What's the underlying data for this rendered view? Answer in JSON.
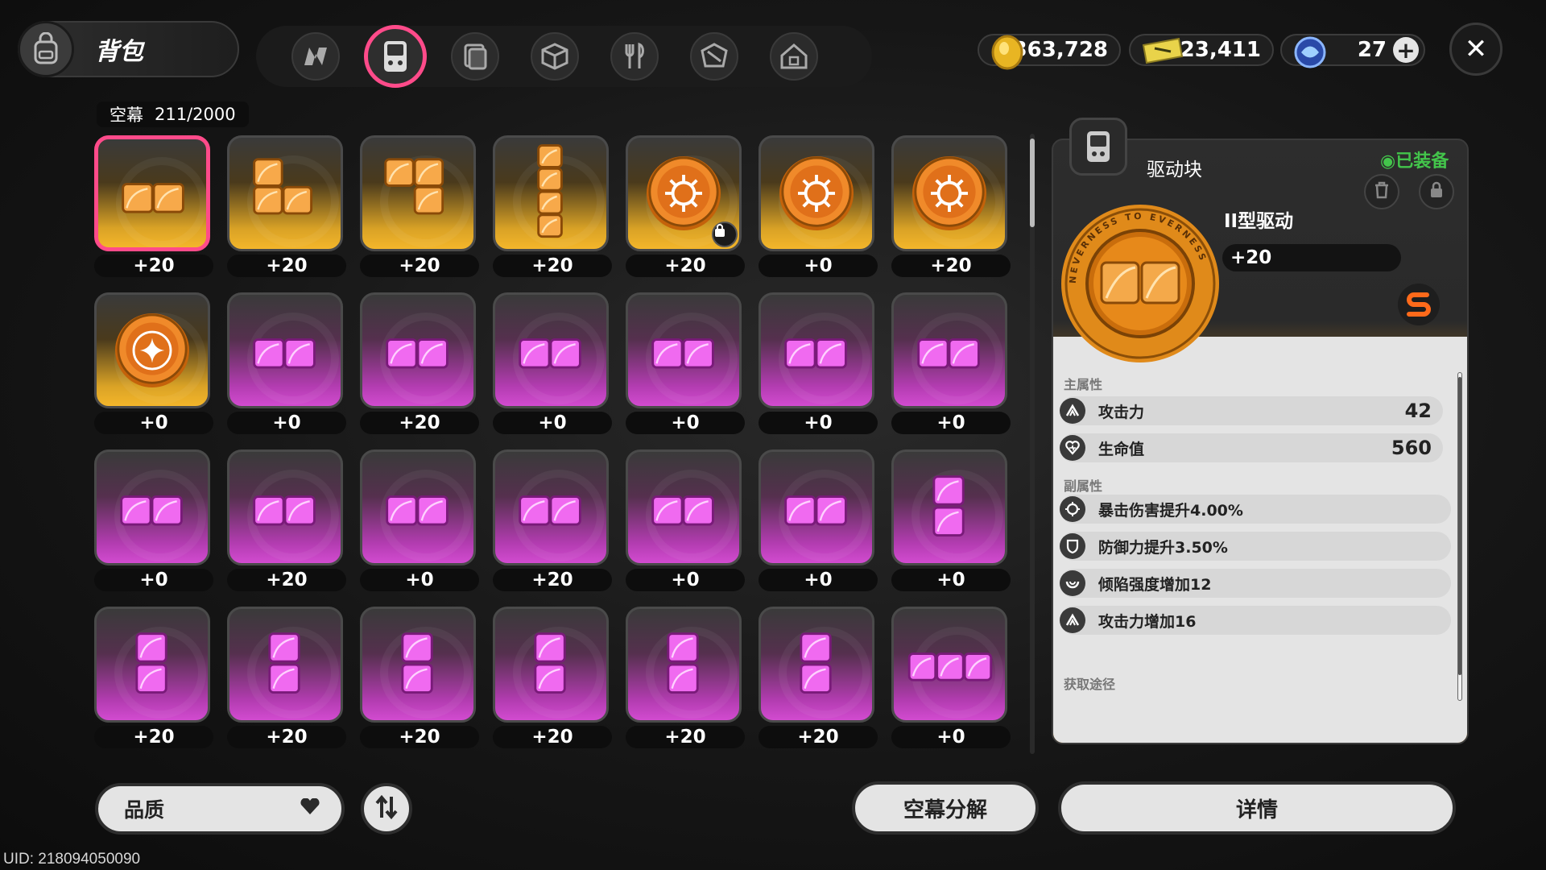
{
  "header": {
    "title": "背包",
    "tabs": [
      {
        "icon": "n-logo-icon",
        "active": false
      },
      {
        "icon": "handheld-device-icon",
        "active": true
      },
      {
        "icon": "cards-icon",
        "active": false
      },
      {
        "icon": "box-icon",
        "active": false
      },
      {
        "icon": "fork-knife-icon",
        "active": false
      },
      {
        "icon": "package-icon",
        "active": false
      },
      {
        "icon": "house-icon",
        "active": false
      }
    ]
  },
  "currencies": [
    {
      "icon": "gold-coin-icon",
      "value": "363,728"
    },
    {
      "icon": "ticket-icon",
      "value": "23,411"
    },
    {
      "icon": "polychrome-icon",
      "value": "27"
    }
  ],
  "inventory": {
    "label": "空幕",
    "count": "211/2000",
    "items": [
      {
        "rarity": "gold",
        "shape": "h2",
        "level": "+20",
        "selected": true
      },
      {
        "rarity": "gold",
        "shape": "L",
        "level": "+20"
      },
      {
        "rarity": "gold",
        "shape": "J",
        "level": "+20"
      },
      {
        "rarity": "gold",
        "shape": "v4",
        "level": "+20"
      },
      {
        "rarity": "gold",
        "shape": "coin",
        "level": "+20",
        "locked": true
      },
      {
        "rarity": "gold",
        "shape": "coin",
        "level": "+0"
      },
      {
        "rarity": "gold",
        "shape": "coin",
        "level": "+20"
      },
      {
        "rarity": "gold",
        "shape": "coin2",
        "level": "+0"
      },
      {
        "rarity": "pink",
        "shape": "h2",
        "level": "+0"
      },
      {
        "rarity": "pink",
        "shape": "h2",
        "level": "+20"
      },
      {
        "rarity": "pink",
        "shape": "h2",
        "level": "+0"
      },
      {
        "rarity": "pink",
        "shape": "h2",
        "level": "+0"
      },
      {
        "rarity": "pink",
        "shape": "h2",
        "level": "+0"
      },
      {
        "rarity": "pink",
        "shape": "h2",
        "level": "+0"
      },
      {
        "rarity": "pink",
        "shape": "h2",
        "level": "+0"
      },
      {
        "rarity": "pink",
        "shape": "h2",
        "level": "+20"
      },
      {
        "rarity": "pink",
        "shape": "h2",
        "level": "+0"
      },
      {
        "rarity": "pink",
        "shape": "h2",
        "level": "+20"
      },
      {
        "rarity": "pink",
        "shape": "h2",
        "level": "+0"
      },
      {
        "rarity": "pink",
        "shape": "h2",
        "level": "+0"
      },
      {
        "rarity": "pink",
        "shape": "v2",
        "level": "+0"
      },
      {
        "rarity": "pink",
        "shape": "v2",
        "level": "+20"
      },
      {
        "rarity": "pink",
        "shape": "v2",
        "level": "+20"
      },
      {
        "rarity": "pink",
        "shape": "v2",
        "level": "+20"
      },
      {
        "rarity": "pink",
        "shape": "v2",
        "level": "+20"
      },
      {
        "rarity": "pink",
        "shape": "v2",
        "level": "+20"
      },
      {
        "rarity": "pink",
        "shape": "v2",
        "level": "+20"
      },
      {
        "rarity": "pink",
        "shape": "h3",
        "level": "+0"
      }
    ]
  },
  "detail": {
    "category": "驱动块",
    "equipped": "◉已装备",
    "name": "II型驱动",
    "level": "+20",
    "medal_text": "NEVERNESS TO EVERNESS",
    "main_label": "主属性",
    "main_stats": [
      {
        "icon": "attack-icon",
        "name": "攻击力",
        "value": "42"
      },
      {
        "icon": "heart-icon",
        "name": "生命值",
        "value": "560"
      }
    ],
    "sub_label": "副属性",
    "sub_stats": [
      {
        "icon": "crit-icon",
        "name": "暴击伤害提升4.00%"
      },
      {
        "icon": "shield-icon",
        "name": "防御力提升3.50%"
      },
      {
        "icon": "swirl-icon",
        "name": "倾陷强度增加12"
      },
      {
        "icon": "attack-icon",
        "name": "攻击力增加16"
      }
    ],
    "source_label": "获取途径"
  },
  "footer": {
    "quality": "品质",
    "decompose": "空幕分解",
    "details": "详情",
    "uid": "UID: 218094050090"
  },
  "colors": {
    "accent": "#ff4b8a",
    "gold": "#f4b62a",
    "pink": "#d24bd0",
    "equipped": "#43c44b"
  }
}
